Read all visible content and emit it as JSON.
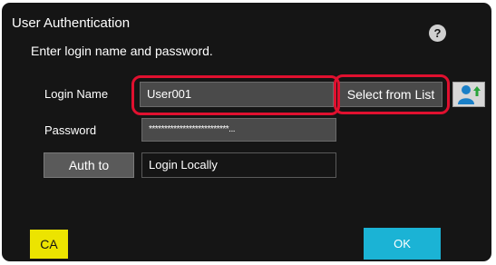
{
  "dialog": {
    "title": "User Authentication",
    "subtitle": "Enter login name and password.",
    "help_icon": "question-circle-icon"
  },
  "form": {
    "login_name_label": "Login Name",
    "login_name_value": "User001",
    "password_label": "Password",
    "password_value": "**************************...",
    "auth_to_button_label": "Auth to",
    "auth_to_value": "Login Locally",
    "select_from_list_label": "Select from List",
    "user_list_icon": "user-select-icon"
  },
  "buttons": {
    "ca_label": "CA",
    "ok_label": "OK"
  },
  "colors": {
    "panel_background": "#151515",
    "highlight_ring": "#e0102f",
    "ca_button": "#ece400",
    "ok_button": "#1bb3d5"
  }
}
